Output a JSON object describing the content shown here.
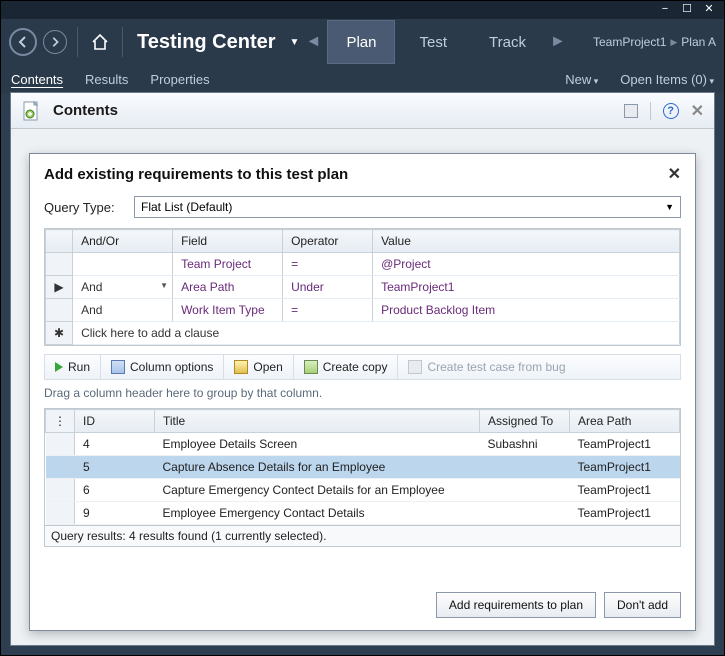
{
  "app": {
    "title": "Testing Center"
  },
  "nav_tabs": {
    "plan": "Plan",
    "test": "Test",
    "track": "Track"
  },
  "breadcrumb": {
    "project": "TeamProject1",
    "plan": "Plan A"
  },
  "subnav": {
    "contents": "Contents",
    "results": "Results",
    "properties": "Properties",
    "new": "New",
    "open_items": "Open Items (0)"
  },
  "contents_panel": {
    "title": "Contents"
  },
  "dialog": {
    "title": "Add existing requirements to this test plan",
    "query_type_label": "Query Type:",
    "query_type_value": "Flat List (Default)",
    "grid_headers": {
      "andor": "And/Or",
      "field": "Field",
      "operator": "Operator",
      "value": "Value"
    },
    "clauses": [
      {
        "rowmark": "",
        "andor": "",
        "field": "Team Project",
        "operator": "=",
        "value": "@Project"
      },
      {
        "rowmark": "▶",
        "andor": "And",
        "andor_dd": true,
        "field": "Area Path",
        "operator": "Under",
        "value": "TeamProject1"
      },
      {
        "rowmark": "",
        "andor": "And",
        "field": "Work Item Type",
        "operator": "=",
        "value": "Product Backlog Item"
      }
    ],
    "add_clause_rowmark": "✱",
    "add_clause_text": "Click here to add a clause",
    "toolbar": {
      "run": "Run",
      "column_options": "Column options",
      "open": "Open",
      "create_copy": "Create copy",
      "create_testcase": "Create test case from bug"
    },
    "group_hint": "Drag a column header here to group by that column.",
    "result_headers": {
      "id": "ID",
      "title": "Title",
      "assigned": "Assigned To",
      "area": "Area Path"
    },
    "results": [
      {
        "id": "4",
        "title": "Employee Details Screen",
        "assigned": "Subashni",
        "area": "TeamProject1",
        "selected": false
      },
      {
        "id": "5",
        "title": "Capture Absence Details for an Employee",
        "assigned": "",
        "area": "TeamProject1",
        "selected": true
      },
      {
        "id": "6",
        "title": "Capture Emergency Contect Details for an Employee",
        "assigned": "",
        "area": "TeamProject1",
        "selected": false
      },
      {
        "id": "9",
        "title": "Employee Emergency Contact Details",
        "assigned": "",
        "area": "TeamProject1",
        "selected": false
      }
    ],
    "status": "Query results: 4 results found (1 currently selected).",
    "add_btn": "Add requirements to plan",
    "dont_add_btn": "Don't add"
  }
}
